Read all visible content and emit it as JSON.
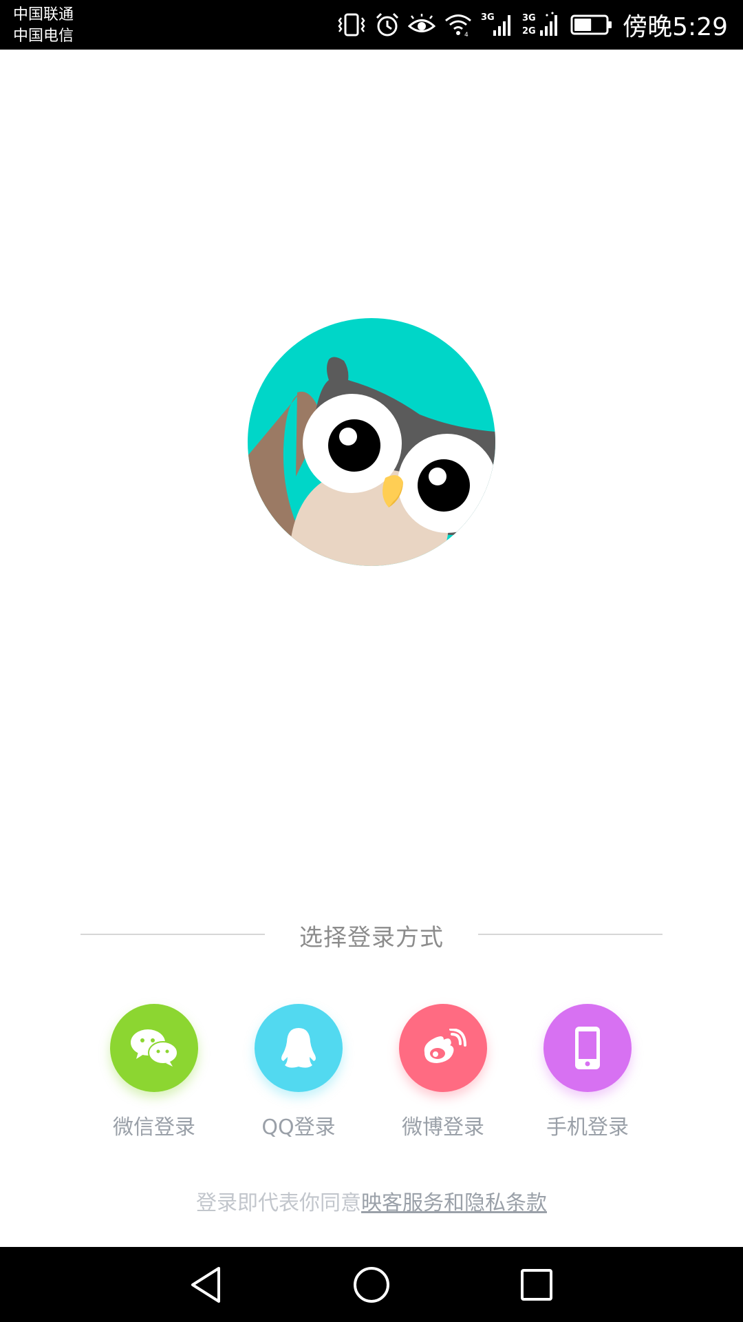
{
  "status_bar": {
    "carrier_1": "中国联通",
    "carrier_2": "中国电信",
    "network_1": "3G",
    "network_2a": "3G",
    "network_2b": "2G",
    "time": "傍晚5:29",
    "battery_percent": 55,
    "icons": [
      "vibrate-icon",
      "alarm-icon",
      "eye-icon",
      "wifi-icon",
      "signal-3g-icon",
      "signal-3g-2g-icon",
      "battery-icon"
    ]
  },
  "login": {
    "section_title": "选择登录方式",
    "options": [
      {
        "label": "微信登录",
        "icon": "wechat-icon",
        "color": "#8cd631"
      },
      {
        "label": "QQ登录",
        "icon": "qq-icon",
        "color": "#52d9f0"
      },
      {
        "label": "微博登录",
        "icon": "weibo-icon",
        "color": "#ff6b82"
      },
      {
        "label": "手机登录",
        "icon": "phone-icon",
        "color": "#d771f2"
      }
    ],
    "agreement_prefix": "登录即代表你同意",
    "agreement_link": "映客服务和隐私条款"
  },
  "nav_bar": {
    "icons": [
      "back-icon",
      "home-icon",
      "recents-icon"
    ]
  },
  "colors": {
    "logo_bg": "#00d6c8",
    "owl_gray": "#5b5b5b",
    "owl_brown": "#9b7a64",
    "owl_belly": "#e9d5c3",
    "owl_beak": "#ffce54"
  }
}
